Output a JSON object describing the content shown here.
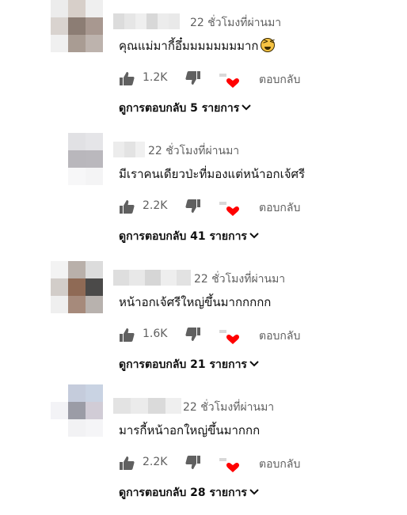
{
  "comments": [
    {
      "time": "22 ชั่วโมงที่ผ่านมา",
      "text": "คุณแม่มากี้อึ๋มมมมมมมมาก",
      "likes": "1.2K",
      "reply_label": "ตอบกลับ",
      "view_replies": "ดูการตอบกลับ 5 รายการ",
      "avatar_colors": [
        "#ececec",
        "#d7cfc9",
        "#efefef",
        "#d9d3cf",
        "#8c7d74",
        "#a89890",
        "#f0f0f0",
        "#a99c93",
        "#bdb3ad"
      ],
      "name_colors": [
        "#dcdcdc",
        "#e6e6e6",
        "#efefef",
        "#d8d8d8",
        "#ececec",
        "#e9e9e9"
      ]
    },
    {
      "time": "22 ชั่วโมงที่ผ่านมา",
      "text": "มีเราคนเดียวป่ะที่มองแต่หน้าอกเจ้ศรี",
      "likes": "2.2K",
      "reply_label": "ตอบกลับ",
      "view_replies": "ดูการตอบกลับ 41 รายการ",
      "avatar_colors": [
        "#ffffff",
        "#e1e1e4",
        "#e5e5e8",
        "#ffffff",
        "#b9b7bc",
        "#bab8bd",
        "#ffffff",
        "#f7f7f8",
        "#f4f4f5"
      ],
      "name_colors": [
        "#ececec",
        "#e3e3e3",
        "#f0f0f0"
      ]
    },
    {
      "time": "22 ชั่วโมงที่ผ่านมา",
      "text": "หน้าอกเจ้ศรีใหญ่ขึ้นมากกกกก",
      "likes": "1.6K",
      "reply_label": "ตอบกลับ",
      "view_replies": "ดูการตอบกลับ 21 รายการ",
      "avatar_colors": [
        "#f3f3f3",
        "#b9b0aa",
        "#dcdcdc",
        "#d2cdc9",
        "#8f6a55",
        "#4b4a49",
        "#efefef",
        "#a68a7b",
        "#b8b2ae"
      ],
      "name_colors": [
        "#dedede",
        "#e8e8e8",
        "#d6d6d6",
        "#eeeeee",
        "#e2e2e2"
      ]
    },
    {
      "time": "22 ชั่วโมงที่ผ่านมา",
      "text": "มารกี้หน้าอกใหญ่ขึ้นมากกก",
      "likes": "2.2K",
      "reply_label": "ตอบกลับ",
      "view_replies": "ดูการตอบกลับ 28 รายการ",
      "avatar_colors": [
        "#ffffff",
        "#c5ccdc",
        "#c9d3e3",
        "#f3f3f6",
        "#9b9ca6",
        "#d1ccd6",
        "#ffffff",
        "#f2f2f4",
        "#f5f5f7"
      ],
      "name_colors": [
        "#e3e3e3",
        "#ebebeb",
        "#dadada",
        "#efefef"
      ]
    }
  ]
}
